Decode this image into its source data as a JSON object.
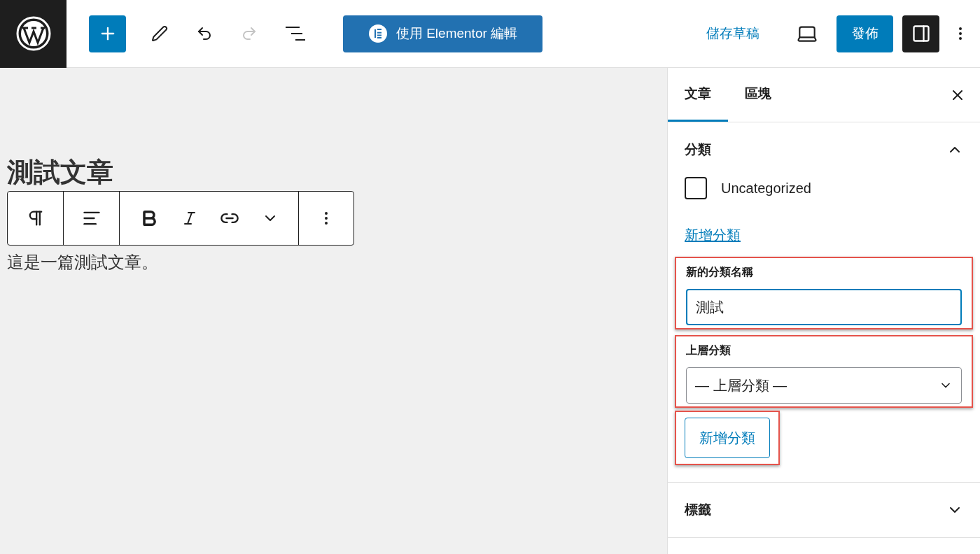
{
  "header": {
    "history": [
      {
        "kind": "undo",
        "disabled": false
      },
      {
        "kind": "redo",
        "disabled": true
      }
    ],
    "elementor_button": "使用 Elementor 編輯",
    "save_draft": "儲存草稿",
    "publish": "發佈",
    "settings_pressed": true
  },
  "editor": {
    "title": "測試文章",
    "paragraph": "這是一篇測試文章。"
  },
  "sidebar": {
    "tabs": [
      {
        "label": "文章",
        "selected": true
      },
      {
        "label": "區塊",
        "selected": false
      }
    ],
    "panels": [
      {
        "title": "分類",
        "expanded": true
      },
      {
        "title": "標籤",
        "expanded": false
      }
    ],
    "categories": [
      {
        "label": "Uncategorized",
        "checked": false
      }
    ],
    "add_link": "新增分類",
    "new_name": {
      "label": "新的分類名稱",
      "value": "測試",
      "highlighted": true
    },
    "parent": {
      "label": "上層分類",
      "value": "— 上層分類 —",
      "highlighted": true
    },
    "submit": {
      "label": "新增分類",
      "highlighted": true
    }
  }
}
